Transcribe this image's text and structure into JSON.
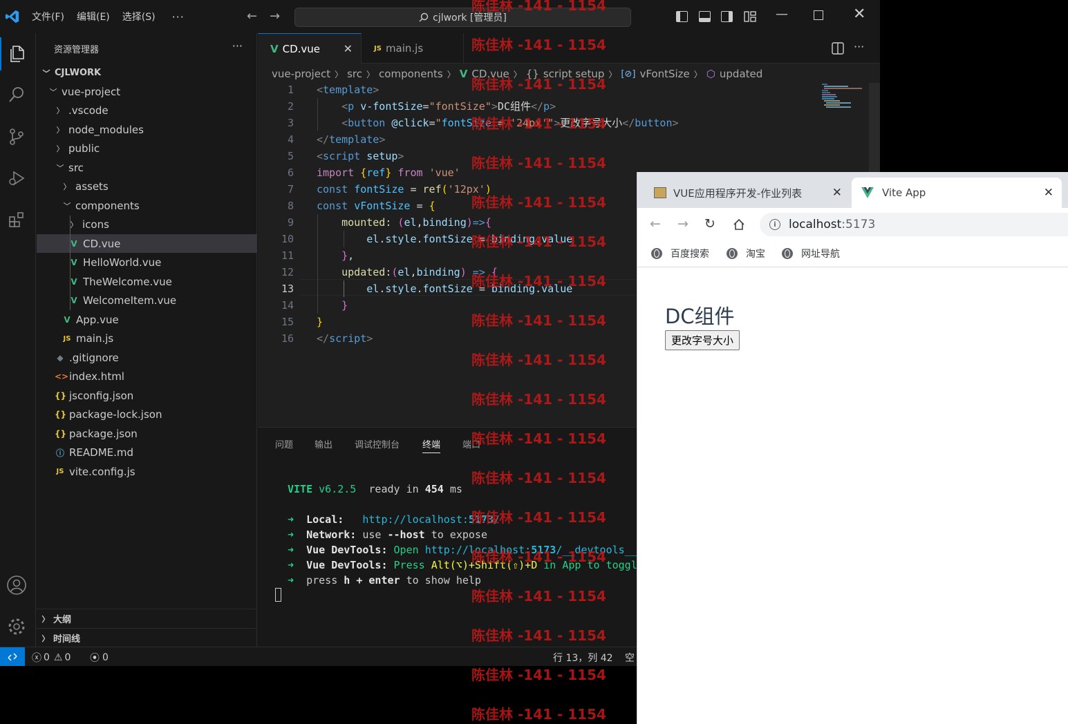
{
  "titlebar": {
    "menu": [
      "文件(F)",
      "编辑(E)",
      "选择(S)"
    ],
    "more": "···",
    "search_text": "cjlwork [管理员]"
  },
  "sidebar": {
    "title": "资源管理器",
    "dots": "···",
    "root": "CJLWORK",
    "items": [
      {
        "label": "vue-project",
        "type": "folder-open",
        "depth": 1
      },
      {
        "label": ".vscode",
        "type": "folder",
        "depth": 2
      },
      {
        "label": "node_modules",
        "type": "folder",
        "depth": 2
      },
      {
        "label": "public",
        "type": "folder",
        "depth": 2
      },
      {
        "label": "src",
        "type": "folder-open",
        "depth": 2
      },
      {
        "label": "assets",
        "type": "folder",
        "depth": 3
      },
      {
        "label": "components",
        "type": "folder-open",
        "depth": 3
      },
      {
        "label": "icons",
        "type": "folder",
        "depth": 4
      },
      {
        "label": "CD.vue",
        "type": "vue",
        "depth": 4
      },
      {
        "label": "HelloWorld.vue",
        "type": "vue",
        "depth": 4
      },
      {
        "label": "TheWelcome.vue",
        "type": "vue",
        "depth": 4
      },
      {
        "label": "WelcomeItem.vue",
        "type": "vue",
        "depth": 4
      },
      {
        "label": "App.vue",
        "type": "vue",
        "depth": 3
      },
      {
        "label": "main.js",
        "type": "js",
        "depth": 3
      },
      {
        "label": ".gitignore",
        "type": "git",
        "depth": 2
      },
      {
        "label": "index.html",
        "type": "html",
        "depth": 2
      },
      {
        "label": "jsconfig.json",
        "type": "json",
        "depth": 2
      },
      {
        "label": "package-lock.json",
        "type": "json",
        "depth": 2
      },
      {
        "label": "package.json",
        "type": "json",
        "depth": 2
      },
      {
        "label": "README.md",
        "type": "info",
        "depth": 2
      },
      {
        "label": "vite.config.js",
        "type": "js",
        "depth": 2
      }
    ],
    "outline": "大纲",
    "timeline": "时间线"
  },
  "editor": {
    "tabs": [
      {
        "label": "CD.vue",
        "icon": "V",
        "active": true
      },
      {
        "label": "main.js",
        "icon": "JS",
        "active": false
      }
    ],
    "breadcrumb": [
      "vue-project",
      "src",
      "components",
      "CD.vue",
      "script setup",
      "vFontSize",
      "updated"
    ],
    "line_numbers": [
      "1",
      "2",
      "3",
      "4",
      "5",
      "6",
      "7",
      "8",
      "9",
      "10",
      "11",
      "12",
      "13",
      "14",
      "15",
      "16"
    ],
    "current_line": 13
  },
  "panel": {
    "tabs": [
      "问题",
      "输出",
      "调试控制台",
      "终端",
      "端口"
    ],
    "active_tab": "终端",
    "terminal": {
      "vite": "VITE",
      "version": "v6.2.5",
      "ready_pre": "ready in",
      "ready_ms": "454",
      "ms": "ms",
      "local_label": "Local:",
      "local_url_pre": "http://localhost:",
      "local_port": "5173",
      "local_url_post": "/",
      "network_label": "Network:",
      "network_use": "use",
      "network_host": "--host",
      "network_post": "to expose",
      "devtools_label": "Vue DevTools:",
      "devtools_open": "Open",
      "devtools_url_pre": "http://localhost:",
      "devtools_port": "5173",
      "devtools_url_post": "/__devtools__",
      "devtools_press": "Press",
      "devtools_keys": "Alt(⌥)+Shift(⇧)+D",
      "devtools_tail": "in App to toggl",
      "help_pre": "press",
      "help_h": "h",
      "help_plus": "+",
      "help_enter": "enter",
      "help_post": "to show help"
    }
  },
  "statusbar": {
    "errors": "0",
    "warnings": "0",
    "ports": "0",
    "position": "行 13，列 42",
    "spaces": "空"
  },
  "browser": {
    "tabs": [
      {
        "label": "VUE应用程序开发-作业列表",
        "active": false
      },
      {
        "label": "Vite App",
        "active": true
      }
    ],
    "url_host": "localhost",
    "url_port": ":5173",
    "bookmarks": [
      "百度搜索",
      "淘宝",
      "网址导航"
    ],
    "page": {
      "heading": "DC组件",
      "button": "更改字号大小"
    }
  },
  "watermark": "陈佳林 -141 - 1154",
  "colors": {
    "accent": "#0078d4",
    "vue_green": "#42b883",
    "watermark_red": "#c41818"
  }
}
